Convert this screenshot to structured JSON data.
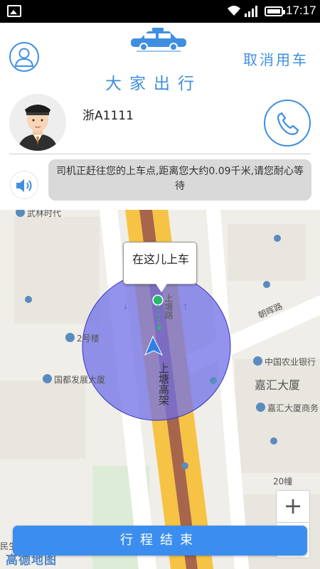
{
  "status_bar": {
    "time": "17:17"
  },
  "header": {
    "cancel_label": "取消用车",
    "title": "大家出行",
    "icons": [
      "user-avatar-icon",
      "taxi-icon"
    ]
  },
  "driver": {
    "plate": "浙A1111",
    "message": "司机正赶往您的上车点,距离您大约0.09千米,请您耐心等待"
  },
  "map": {
    "pickup_label": "在这儿上车",
    "labels": {
      "wulin": "武林时代",
      "building2": "2号楼",
      "guodu": "国都发展大厦",
      "agri_bank": "中国农业银行",
      "jiahui": "嘉汇大厦",
      "jiahui_shop": "嘉汇大厦商务",
      "chaohui": "朝晖路",
      "shangtang_road": "上塘路",
      "shangtang_elevated": "上塘高架",
      "building20": "20幢",
      "minsheng": "民生"
    },
    "zoom_in_label": "+",
    "logo_text": "高德地图",
    "accent_color": "#3b8ef0",
    "radius_color": "#6f6fe8"
  },
  "footer": {
    "end_trip_label": "行程结束"
  }
}
